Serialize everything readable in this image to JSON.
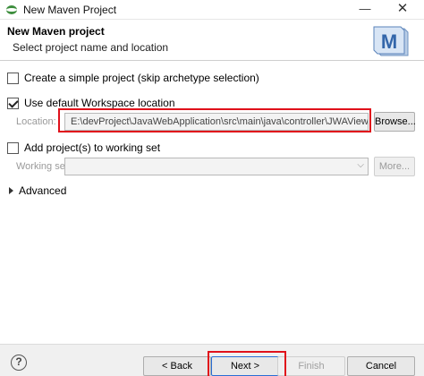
{
  "window": {
    "title": "New Maven Project",
    "minimize_glyph": "—",
    "close_glyph": "✕"
  },
  "banner": {
    "title": "New Maven project",
    "description": "Select project name and location",
    "logo_letter": "M"
  },
  "options": {
    "simple_project": {
      "label": "Create a simple project (skip archetype selection)",
      "checked": false
    },
    "default_workspace": {
      "label": "Use default Workspace location",
      "checked": true
    },
    "location_label": "Location:",
    "location_value": "E:\\devProject\\JavaWebApplication\\src\\main\\java\\controller\\JWAView.java",
    "browse_button": "Browse...",
    "add_working_set": {
      "label": "Add project(s) to working set",
      "checked": false
    },
    "working_set_label": "Working set:",
    "working_set_value": "",
    "more_button": "More...",
    "advanced_label": "Advanced"
  },
  "footer": {
    "help_glyph": "?",
    "back_button": "< Back",
    "next_button": "Next >",
    "finish_button": "Finish",
    "cancel_button": "Cancel"
  },
  "colors": {
    "highlight": "#e0111b",
    "primary_border": "#2a6ed4"
  }
}
